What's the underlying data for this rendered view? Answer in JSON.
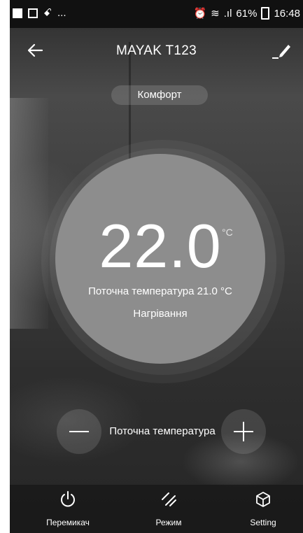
{
  "status_bar": {
    "battery": "61%",
    "time": "16:48"
  },
  "header": {
    "title": "MAYAK T123"
  },
  "mode": {
    "label": "Комфорт"
  },
  "dial": {
    "set_temp": "22.0",
    "unit": "°C",
    "current_temp": "Поточна температура 21.0 °C",
    "state": "Нагрівання"
  },
  "stepper": {
    "label": "Поточна температура"
  },
  "bottom_nav": {
    "items": [
      {
        "label": "Перемикач",
        "icon": "power-icon"
      },
      {
        "label": "Режим",
        "icon": "mode-icon"
      },
      {
        "label": "Setting",
        "icon": "settings-cube-icon"
      }
    ]
  }
}
